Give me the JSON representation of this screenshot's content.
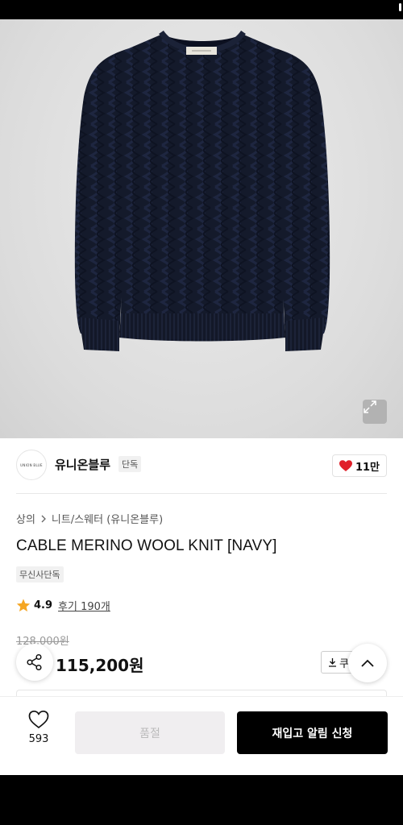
{
  "brand": {
    "logo_text": "UNION BLUE",
    "name": "유니온블루",
    "tag": "단독"
  },
  "like": {
    "count": "11만"
  },
  "breadcrumb": {
    "category": "상의",
    "subcategory": "니트/스웨터 (유니온블루)"
  },
  "product": {
    "title": "CABLE MERINO WOOL KNIT [NAVY]",
    "badge": "무신사단독",
    "rating": "4.9",
    "reviews": "후기 190개",
    "original_price": "128,000원",
    "sale_price": "115,200원"
  },
  "coupon": {
    "label": "쿠"
  },
  "bottom_bar": {
    "wish_count": "593",
    "soldout_label": "품절",
    "restock_label": "재입고 알림 신청"
  },
  "colors": {
    "sweater": "#141a2b",
    "heart": "#e0202a",
    "star": "#f5a623"
  },
  "icons": [
    "expand-icon",
    "heart-filled-icon",
    "chevron-right-icon",
    "star-icon",
    "share-icon",
    "download-icon",
    "chevron-up-icon",
    "heart-outline-icon"
  ]
}
